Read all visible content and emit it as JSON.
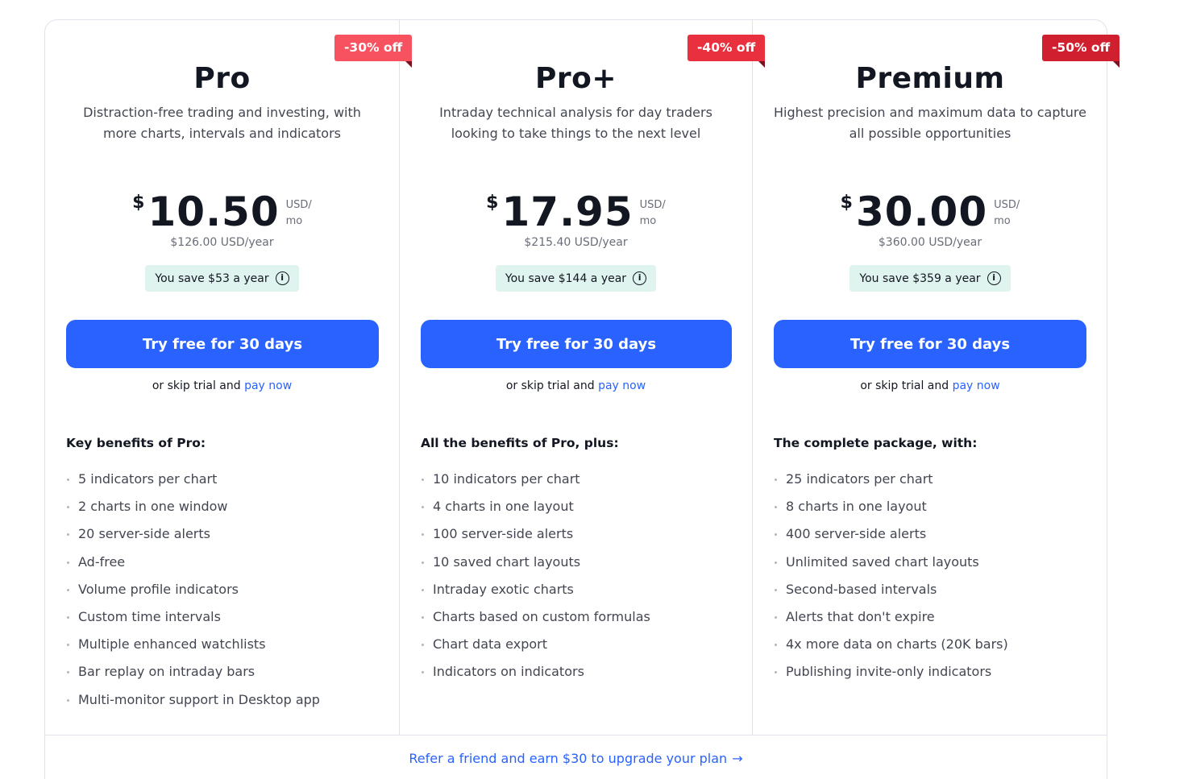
{
  "plans": [
    {
      "name": "Pro",
      "badge": "-30% off",
      "badge_color": "#f7525f",
      "description": "Distraction-free trading and investing, with more charts, intervals and indicators",
      "currency": "$",
      "price": "10.50",
      "unit_line1": "USD/",
      "unit_line2": "mo",
      "yearly": "$126.00 USD/year",
      "save": "You save $53 a year",
      "cta": "Try free for 30 days",
      "skip_prefix": "or skip trial and",
      "skip_link": "pay now",
      "benefits_title": "Key benefits of Pro:",
      "benefits": [
        "5 indicators per chart",
        "2 charts in one window",
        "20 server-side alerts",
        "Ad-free",
        "Volume profile indicators",
        "Custom time intervals",
        "Multiple enhanced watchlists",
        "Bar replay on intraday bars",
        "Multi-monitor support in Desktop app"
      ]
    },
    {
      "name": "Pro+",
      "badge": "-40% off",
      "badge_color": "#e8303f",
      "description": "Intraday technical analysis for day traders looking to take things to the next level",
      "currency": "$",
      "price": "17.95",
      "unit_line1": "USD/",
      "unit_line2": "mo",
      "yearly": "$215.40 USD/year",
      "save": "You save $144 a year",
      "cta": "Try free for 30 days",
      "skip_prefix": "or skip trial and",
      "skip_link": "pay now",
      "benefits_title": "All the benefits of Pro, plus:",
      "benefits": [
        "10 indicators per chart",
        "4 charts in one layout",
        "100 server-side alerts",
        "10 saved chart layouts",
        "Intraday exotic charts",
        "Charts based on custom formulas",
        "Chart data export",
        "Indicators on indicators"
      ]
    },
    {
      "name": "Premium",
      "badge": "-50% off",
      "badge_color": "#d0202f",
      "description": "Highest precision and maximum data to capture all possible opportunities",
      "currency": "$",
      "price": "30.00",
      "unit_line1": "USD/",
      "unit_line2": "mo",
      "yearly": "$360.00 USD/year",
      "save": "You save $359 a year",
      "cta": "Try free for 30 days",
      "skip_prefix": "or skip trial and",
      "skip_link": "pay now",
      "benefits_title": "The complete package, with:",
      "benefits": [
        "25 indicators per chart",
        "8 charts in one layout",
        "400 server-side alerts",
        "Unlimited saved chart layouts",
        "Second-based intervals",
        "Alerts that don't expire",
        "4x more data on charts (20K bars)",
        "Publishing invite-only indicators"
      ]
    }
  ],
  "info_icon_name": "info-icon",
  "refer": {
    "text": "Refer a friend and earn $30 to upgrade your plan",
    "arrow": "→"
  },
  "colors": {
    "accent": "#2962ff",
    "save_bg": "#dff3ef",
    "border": "#e0e3eb"
  }
}
